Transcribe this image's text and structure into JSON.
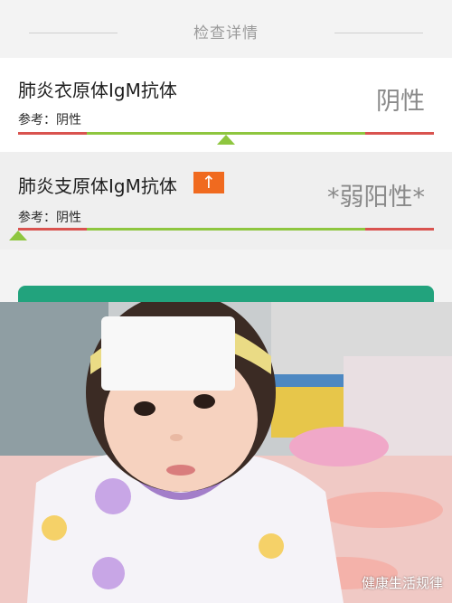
{
  "header": {
    "title": "检查详情"
  },
  "items": [
    {
      "name": "肺炎衣原体IgM抗体",
      "reference": "参考：阴性",
      "result": "阴性",
      "flag": ""
    },
    {
      "name": "肺炎支原体IgM抗体",
      "reference": "参考：阴性",
      "result": "*弱阳性*",
      "flag": "↑"
    }
  ],
  "watermark": "健康生活规律",
  "colors": {
    "range_normal": "#8ec63f",
    "range_abnormal": "#d9534f",
    "flag_bg": "#f06a1f",
    "button_green": "#22a37d"
  },
  "icons": {
    "flag": "up-arrow-icon",
    "watermark": "logo-icon"
  }
}
